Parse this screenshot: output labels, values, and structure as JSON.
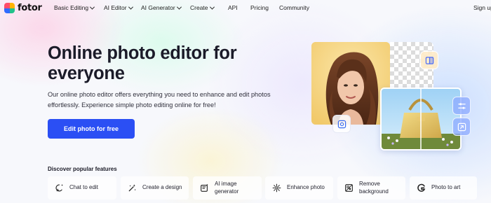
{
  "nav": {
    "brand": "fotor",
    "items": [
      {
        "label": "Basic Editing",
        "dropdown": true
      },
      {
        "label": "AI Editor",
        "dropdown": true
      },
      {
        "label": "AI Generator",
        "dropdown": true
      },
      {
        "label": "Create",
        "dropdown": true
      },
      {
        "label": "API",
        "dropdown": false
      },
      {
        "label": "Pricing",
        "dropdown": false
      },
      {
        "label": "Community",
        "dropdown": false
      }
    ],
    "signup_label": "Sign up"
  },
  "hero": {
    "title": "Online photo editor for everyone",
    "subtitle": "Our online photo editor offers everything you need to enhance and edit photos effortlessly. Experience simple photo editing online for free!",
    "cta_label": "Edit photo for free"
  },
  "features": {
    "heading": "Discover popular features",
    "items": [
      {
        "label": "Chat to edit",
        "icon": "chat-edit-icon"
      },
      {
        "label": "Create a design",
        "icon": "magic-wand-icon"
      },
      {
        "label": "AI image generator",
        "icon": "ai-image-icon"
      },
      {
        "label": "Enhance photo",
        "icon": "enhance-icon"
      },
      {
        "label": "Remove background",
        "icon": "remove-bg-icon"
      },
      {
        "label": "Photo to art",
        "icon": "art-icon"
      }
    ]
  },
  "colors": {
    "accent": "#2b4ff4",
    "text": "#1b1b29"
  }
}
